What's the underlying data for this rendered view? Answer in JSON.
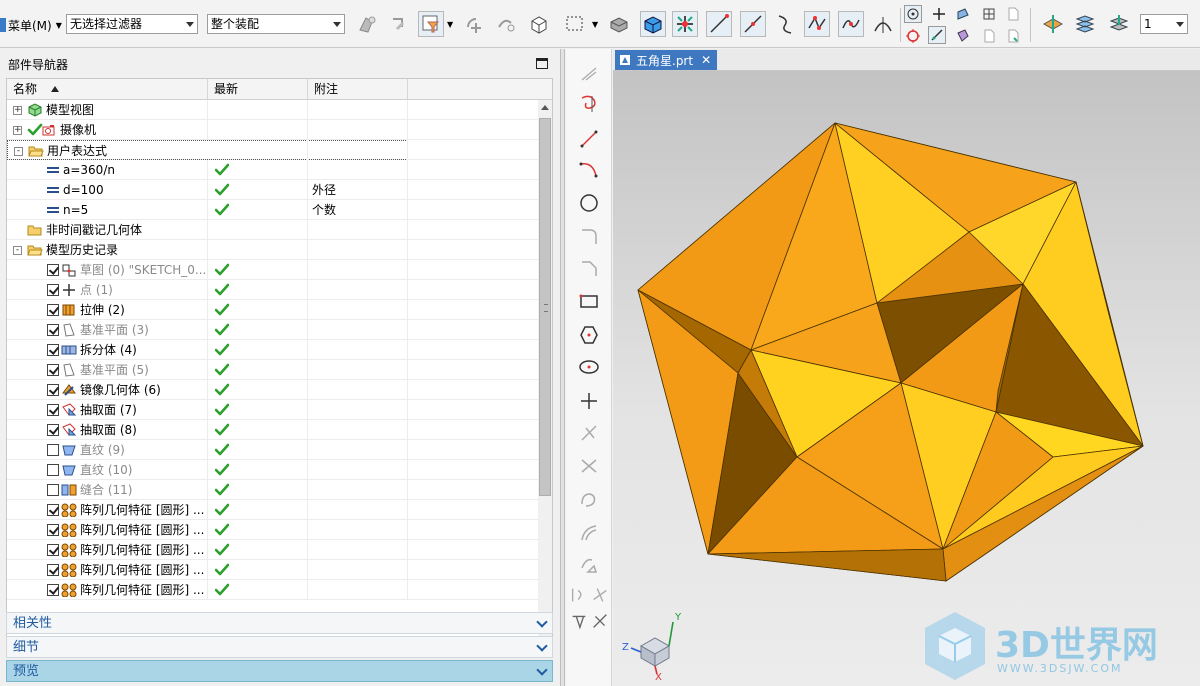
{
  "toolbar": {
    "menu_label": "菜单(M)",
    "filter_select": "无选择过滤器",
    "scope_select": "整个装配",
    "count_value": "1"
  },
  "navigator": {
    "title": "部件导航器",
    "columns": [
      "名称",
      "最新",
      "附注"
    ],
    "rows": [
      {
        "label": "模型视图",
        "indent": 0,
        "expander": "+",
        "icon": "model-views-icon",
        "checkbox": null,
        "latest": false,
        "note": "",
        "grey": false
      },
      {
        "label": "摄像机",
        "indent": 0,
        "expander": "+",
        "icon": "camera-icon",
        "checkbox": "tick",
        "latest": false,
        "note": "",
        "grey": false
      },
      {
        "label": "用户表达式",
        "indent": 0,
        "expander": "-",
        "icon": "folder-open-icon",
        "checkbox": null,
        "latest": false,
        "note": "",
        "grey": false,
        "selected": true
      },
      {
        "label": "a=360/n",
        "indent": 1,
        "expander": null,
        "icon": "expression-icon",
        "checkbox": null,
        "latest": true,
        "note": "",
        "grey": false
      },
      {
        "label": "d=100",
        "indent": 1,
        "expander": null,
        "icon": "expression-icon",
        "checkbox": null,
        "latest": true,
        "note": "外径",
        "grey": false
      },
      {
        "label": "n=5",
        "indent": 1,
        "expander": null,
        "icon": "expression-icon",
        "checkbox": null,
        "latest": true,
        "note": "个数",
        "grey": false
      },
      {
        "label": "非时间戳记几何体",
        "indent": 0,
        "expander": null,
        "icon": "folder-icon",
        "checkbox": null,
        "latest": false,
        "note": "",
        "grey": false
      },
      {
        "label": "模型历史记录",
        "indent": 0,
        "expander": "-",
        "icon": "folder-open-icon",
        "checkbox": null,
        "latest": false,
        "note": "",
        "grey": false
      },
      {
        "label": "草图 (0) \"SKETCH_0...",
        "indent": 1,
        "expander": null,
        "icon": "sketch-icon",
        "checkbox": "on",
        "latest": true,
        "note": "",
        "grey": true
      },
      {
        "label": "点 (1)",
        "indent": 1,
        "expander": null,
        "icon": "point-icon",
        "checkbox": "on",
        "latest": true,
        "note": "",
        "grey": true
      },
      {
        "label": "拉伸 (2)",
        "indent": 1,
        "expander": null,
        "icon": "extrude-icon",
        "checkbox": "on",
        "latest": true,
        "note": "",
        "grey": false
      },
      {
        "label": "基准平面 (3)",
        "indent": 1,
        "expander": null,
        "icon": "datum-plane-icon",
        "checkbox": "on",
        "latest": true,
        "note": "",
        "grey": true
      },
      {
        "label": "拆分体 (4)",
        "indent": 1,
        "expander": null,
        "icon": "split-body-icon",
        "checkbox": "on",
        "latest": true,
        "note": "",
        "grey": false
      },
      {
        "label": "基准平面 (5)",
        "indent": 1,
        "expander": null,
        "icon": "datum-plane-icon",
        "checkbox": "on",
        "latest": true,
        "note": "",
        "grey": true
      },
      {
        "label": "镜像几何体 (6)",
        "indent": 1,
        "expander": null,
        "icon": "mirror-geometry-icon",
        "checkbox": "on",
        "latest": true,
        "note": "",
        "grey": false
      },
      {
        "label": "抽取面 (7)",
        "indent": 1,
        "expander": null,
        "icon": "extract-face-icon",
        "checkbox": "on",
        "latest": true,
        "note": "",
        "grey": false
      },
      {
        "label": "抽取面 (8)",
        "indent": 1,
        "expander": null,
        "icon": "extract-face-icon",
        "checkbox": "on",
        "latest": true,
        "note": "",
        "grey": false
      },
      {
        "label": "直纹 (9)",
        "indent": 1,
        "expander": null,
        "icon": "ruled-surface-icon",
        "checkbox": "off",
        "latest": true,
        "note": "",
        "grey": true
      },
      {
        "label": "直纹 (10)",
        "indent": 1,
        "expander": null,
        "icon": "ruled-surface-icon",
        "checkbox": "off",
        "latest": true,
        "note": "",
        "grey": true
      },
      {
        "label": "缝合 (11)",
        "indent": 1,
        "expander": null,
        "icon": "sew-icon",
        "checkbox": "off",
        "latest": true,
        "note": "",
        "grey": true
      },
      {
        "label": "阵列几何特征 [圆形] ...",
        "indent": 1,
        "expander": null,
        "icon": "pattern-geometry-icon",
        "checkbox": "on",
        "latest": true,
        "note": "",
        "grey": false
      },
      {
        "label": "阵列几何特征 [圆形] ...",
        "indent": 1,
        "expander": null,
        "icon": "pattern-geometry-icon",
        "checkbox": "on",
        "latest": true,
        "note": "",
        "grey": false
      },
      {
        "label": "阵列几何特征 [圆形] ...",
        "indent": 1,
        "expander": null,
        "icon": "pattern-geometry-icon",
        "checkbox": "on",
        "latest": true,
        "note": "",
        "grey": false
      },
      {
        "label": "阵列几何特征 [圆形] ...",
        "indent": 1,
        "expander": null,
        "icon": "pattern-geometry-icon",
        "checkbox": "on",
        "latest": true,
        "note": "",
        "grey": false
      },
      {
        "label": "阵列几何特征 [圆形] ...",
        "indent": 1,
        "expander": null,
        "icon": "pattern-geometry-icon",
        "checkbox": "on",
        "latest": true,
        "note": "",
        "grey": false
      }
    ],
    "panels": [
      {
        "label": "相关性",
        "active": false
      },
      {
        "label": "细节",
        "active": false
      },
      {
        "label": "预览",
        "active": true
      }
    ]
  },
  "graphics": {
    "tab_label": "五角星.prt",
    "axis_labels": {
      "x": "X",
      "y": "Y",
      "z": "Z"
    },
    "watermark_text": "3D世界网",
    "watermark_url": "WWW.3DSJW.COM"
  },
  "colors": {
    "accent": "#3d78c1",
    "check_green": "#2aa12a",
    "solid_light": "#ffd21f",
    "solid_mid": "#f29a15",
    "solid_dark": "#8a5500"
  }
}
